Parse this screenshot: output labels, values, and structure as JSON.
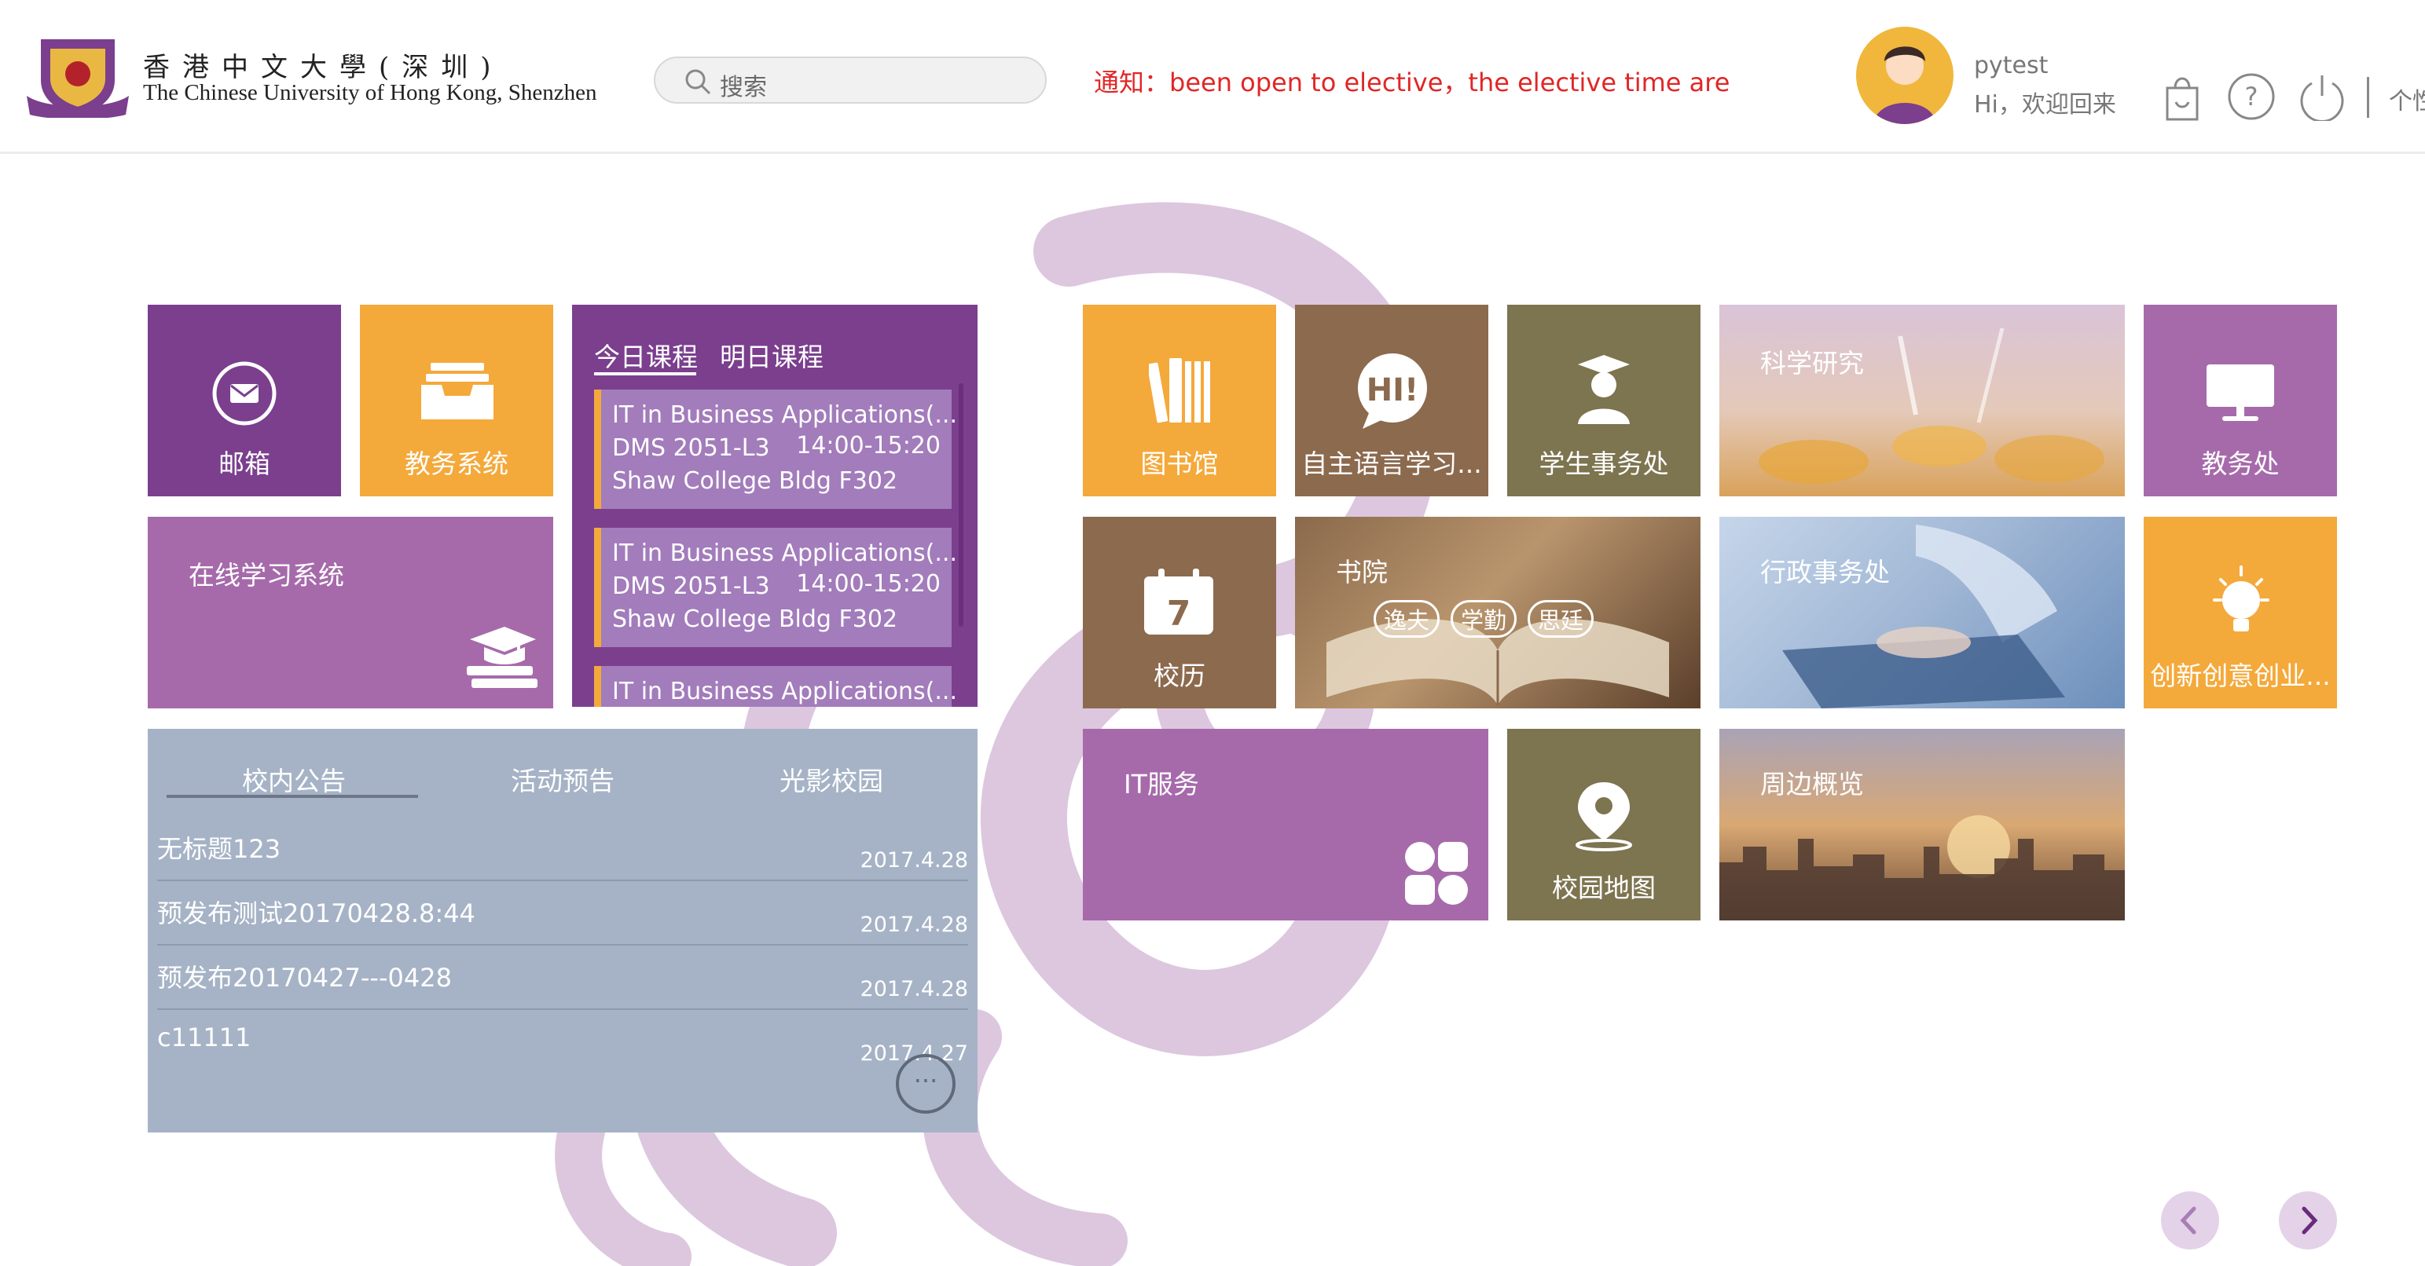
{
  "header": {
    "logo_zh": "香港中文大學(深圳)",
    "logo_en": "The Chinese University of Hong Kong, Shenzhen",
    "search_placeholder": "搜索",
    "notice": "通知：been open to elective，the elective time are",
    "user_name": "pytest",
    "welcome": "Hi，欢迎回来",
    "personal_partial": "个性"
  },
  "tiles": {
    "mail": "邮箱",
    "academic_system": "教务系统",
    "online_learning": "在线学习系统",
    "library": "图书馆",
    "self_language": "自主语言学习...",
    "student_affairs": "学生事务处",
    "research": "科学研究",
    "registry": "教务处",
    "calendar": "校历",
    "calendar_day": "7",
    "colleges": "书院",
    "college_tags": [
      "逸夫",
      "学勤",
      "思廷"
    ],
    "admin_affairs": "行政事务处",
    "innovation": "创新创意创业...",
    "it_services": "IT服务",
    "campus_map": "校园地图",
    "surroundings": "周边概览"
  },
  "course": {
    "tab_today": "今日课程",
    "tab_tomorrow": "明日课程",
    "items": [
      {
        "title": "IT in Business Applications(...",
        "code": "DMS 2051-L3",
        "time": "14:00-15:20",
        "room": "Shaw College Bldg F302"
      },
      {
        "title": "IT in Business Applications(...",
        "code": "DMS 2051-L3",
        "time": "14:00-15:20",
        "room": "Shaw College Bldg F302"
      },
      {
        "title": "IT in Business Applications(...",
        "code": "",
        "time": "",
        "room": ""
      }
    ]
  },
  "news": {
    "tabs": [
      "校内公告",
      "活动预告",
      "光影校园"
    ],
    "items": [
      {
        "title": "无标题123",
        "date": "2017.4.28"
      },
      {
        "title": "预发布测试20170428.8:44",
        "date": "2017.4.28"
      },
      {
        "title": "预发布20170427---0428",
        "date": "2017.4.28"
      },
      {
        "title": "c11111",
        "date": "2017.4.27"
      }
    ],
    "more": "···"
  },
  "colors": {
    "purple": "#7b3f8e",
    "orange": "#f4a93b",
    "brown": "#8c6a4e",
    "olive": "#7d7450",
    "lilac": "#a66aab",
    "news_bg": "#a6b3c6",
    "notice_red": "#e12626"
  }
}
